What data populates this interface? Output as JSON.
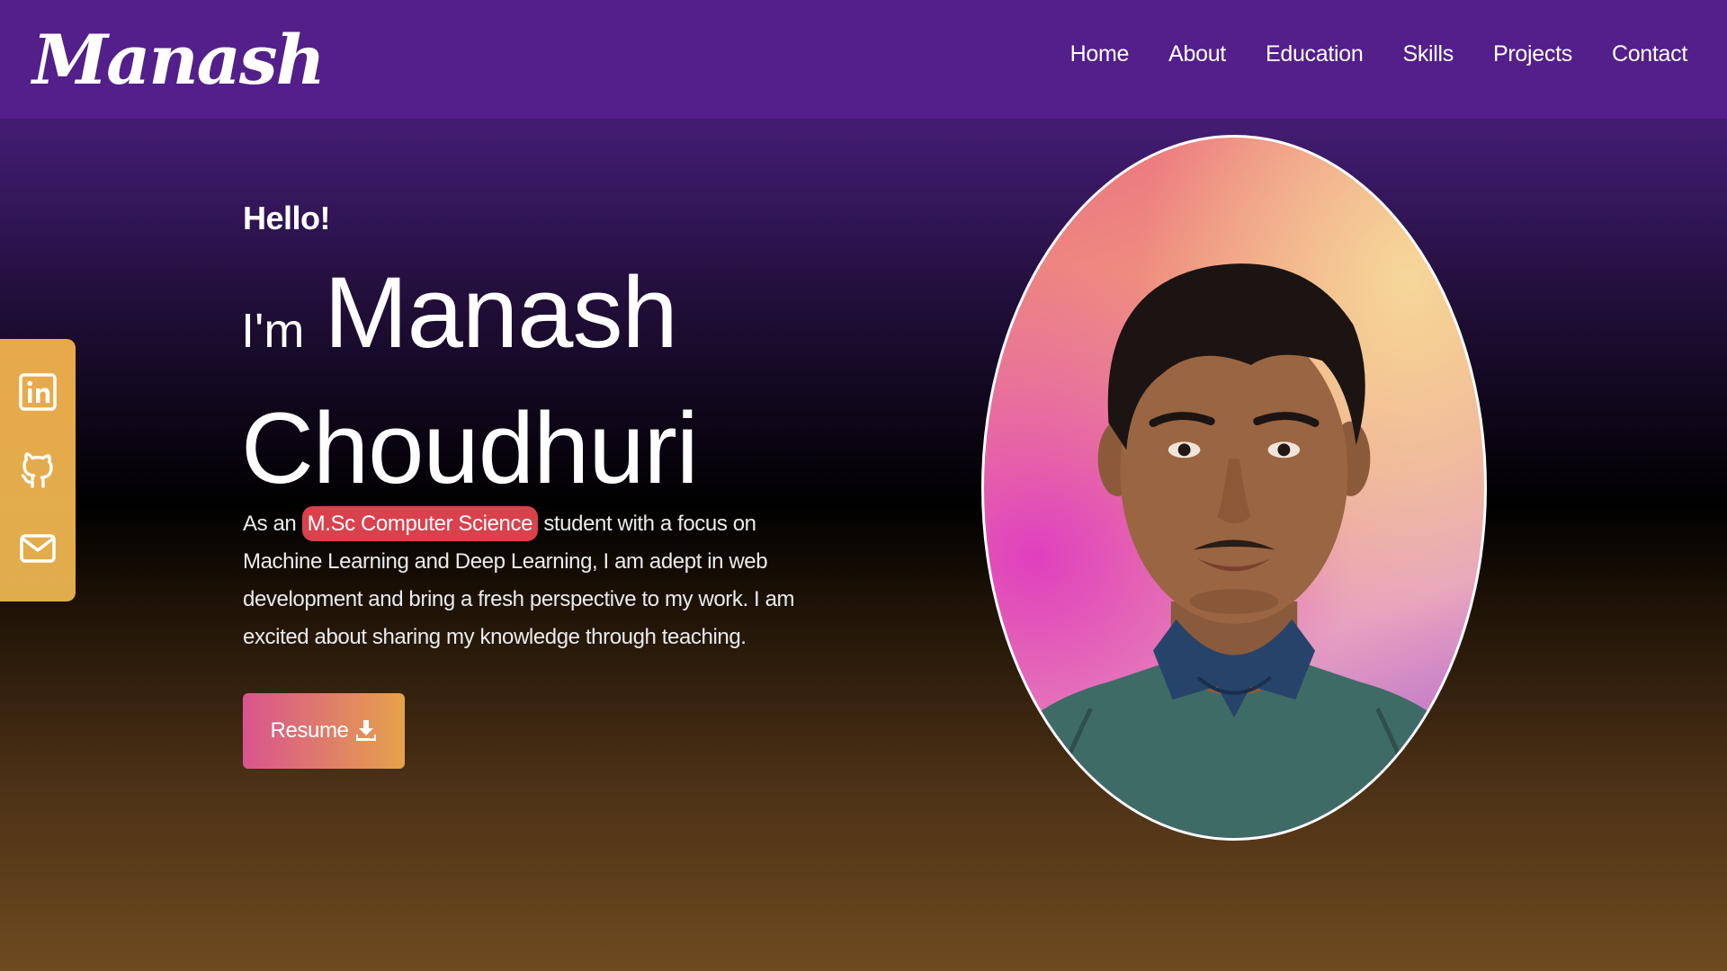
{
  "brand": {
    "logo_text": "Manash"
  },
  "nav": {
    "items": [
      {
        "label": "Home"
      },
      {
        "label": "About"
      },
      {
        "label": "Education"
      },
      {
        "label": "Skills"
      },
      {
        "label": "Projects"
      },
      {
        "label": "Contact"
      }
    ]
  },
  "social": {
    "accent_color": "#e8a94a",
    "links": [
      {
        "icon": "linkedin-icon"
      },
      {
        "icon": "github-icon"
      },
      {
        "icon": "mail-icon"
      }
    ]
  },
  "hero": {
    "greeting": "Hello!",
    "im": "I'm",
    "first_name": "Manash",
    "last_name": "Choudhuri",
    "description_prefix": "As an",
    "highlight": "M.Sc Computer Science",
    "description_suffix": "student with a focus on Machine Learning and Deep Learning, I am adept in web development and bring a fresh perspective to my work. I am excited about sharing my knowledge through teaching.",
    "resume_label": "Resume",
    "resume_icon": "download-icon",
    "highlight_color": "#d9414c"
  },
  "portrait": {
    "alt": "profile-photo"
  },
  "colors": {
    "navbar": "#531f8a",
    "button_gradient_start": "#d9548f",
    "button_gradient_end": "#e6a24a"
  }
}
